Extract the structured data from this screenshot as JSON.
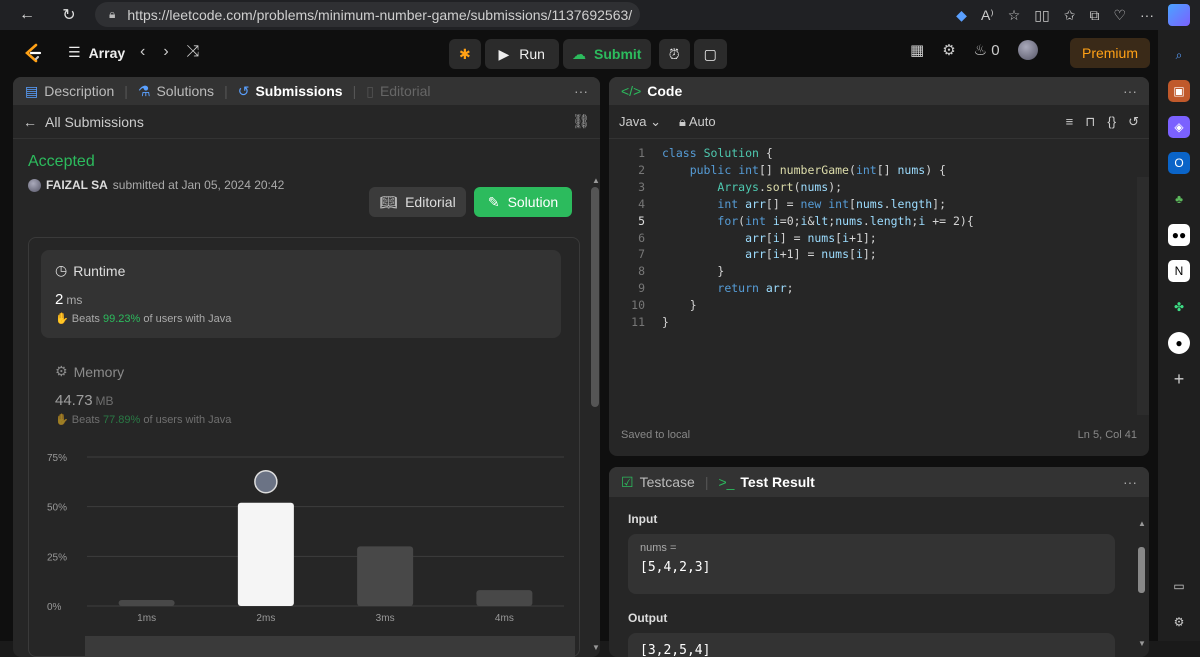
{
  "browser": {
    "url": "https://leetcode.com/problems/minimum-number-game/submissions/1137692563/",
    "reader_mode": "A⁾"
  },
  "nav": {
    "problem_list_label": "Array",
    "run_label": "Run",
    "submit_label": "Submit",
    "streak_count": "0",
    "premium_label": "Premium"
  },
  "left_panel": {
    "tabs": [
      {
        "label": "Description"
      },
      {
        "label": "Solutions"
      },
      {
        "label": "Submissions"
      },
      {
        "label": "Editorial"
      }
    ],
    "all_submissions": "All Submissions",
    "status": "Accepted",
    "user": "FAIZAL SA",
    "submitted_text": "submitted at Jan 05, 2024 20:42",
    "editorial_button": "Editorial",
    "solution_button": "Solution",
    "runtime": {
      "title": "Runtime",
      "value": "2",
      "unit": "ms",
      "beats_label": "Beats",
      "beats_pct": "99.23%",
      "beats_suffix": "of users with Java"
    },
    "memory": {
      "title": "Memory",
      "value": "44.73",
      "unit": "MB",
      "beats_label": "Beats",
      "beats_pct": "77.89%",
      "beats_suffix": "of users with Java"
    }
  },
  "chart_data": {
    "type": "bar",
    "categories": [
      "1ms",
      "2ms",
      "3ms",
      "4ms"
    ],
    "values": [
      3,
      52,
      30,
      8
    ],
    "highlight_index": 1,
    "yticks": [
      "0%",
      "25%",
      "50%",
      "75%"
    ],
    "ylim": [
      0,
      75
    ],
    "grid": true
  },
  "code_panel": {
    "title": "Code",
    "language": "Java",
    "mode": "Auto",
    "status_left": "Saved to local",
    "status_right": "Ln 5, Col 41",
    "current_line": 5,
    "lines": [
      "class Solution {",
      "    public int[] numberGame(int[] nums) {",
      "        Arrays.sort(nums);",
      "        int arr[] = new int[nums.length];",
      "        for(int i=0;i<nums.length;i += 2){",
      "            arr[i] = nums[i+1];",
      "            arr[i+1] = nums[i];",
      "        }",
      "        return arr;",
      "    }",
      "}"
    ]
  },
  "test_panel": {
    "tab_testcase": "Testcase",
    "tab_result": "Test Result",
    "input_label": "Input",
    "input_var": "nums =",
    "input_value": "[5,4,2,3]",
    "output_label": "Output",
    "output_value": "[3,2,5,4]"
  },
  "colors": {
    "accent_green": "#2cbb5d",
    "premium_orange": "#ffa116"
  }
}
